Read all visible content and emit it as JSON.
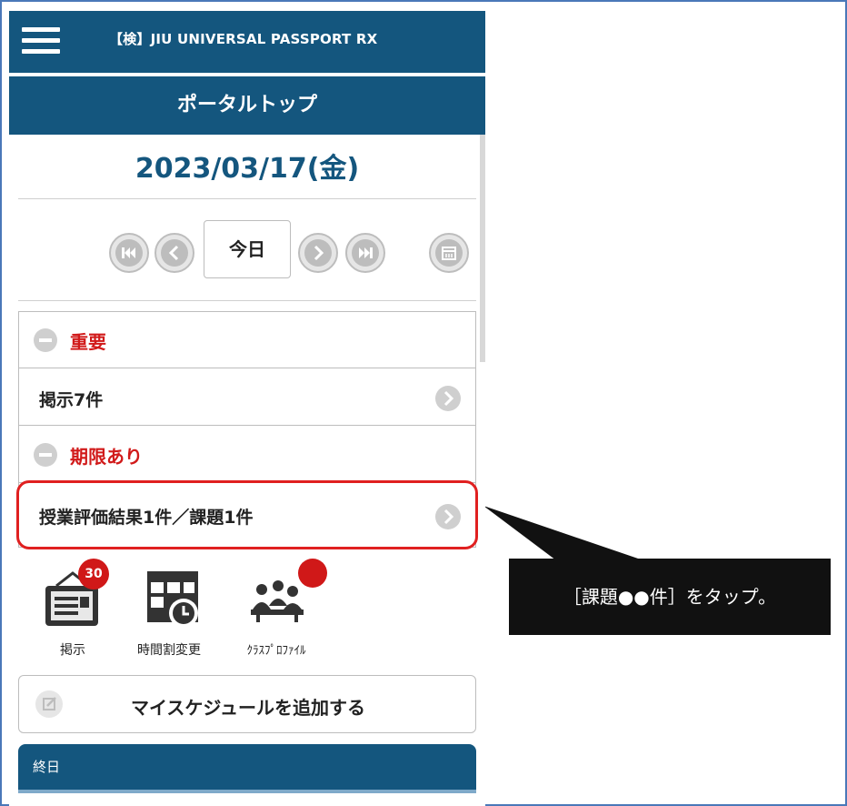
{
  "header": {
    "app_title": "【検】JIU UNIVERSAL PASSPORT RX"
  },
  "page": {
    "title": "ポータルトップ",
    "date": "2023/03/17(金)"
  },
  "nav": {
    "today_label": "今日"
  },
  "sections": {
    "important": {
      "label": "重要",
      "item": "掲示7件"
    },
    "deadline": {
      "label": "期限あり",
      "item": "授業評価結果1件／課題1件"
    }
  },
  "shortcuts": [
    {
      "label": "掲示",
      "badge": "30"
    },
    {
      "label": "時間割変更"
    },
    {
      "label": "ｸﾗｽﾌﾟﾛﾌｧｲﾙ"
    }
  ],
  "add_schedule": {
    "label": "マイスケジュールを追加する"
  },
  "allday": {
    "label": "終日"
  },
  "callout": {
    "text": "［課題●●件］をタップ。"
  },
  "colors": {
    "header_bg": "#14567e",
    "accent_red": "#d11a1a",
    "highlight_border": "#e02020",
    "callout_bg": "#111111",
    "frame_border": "#4a78b8"
  }
}
